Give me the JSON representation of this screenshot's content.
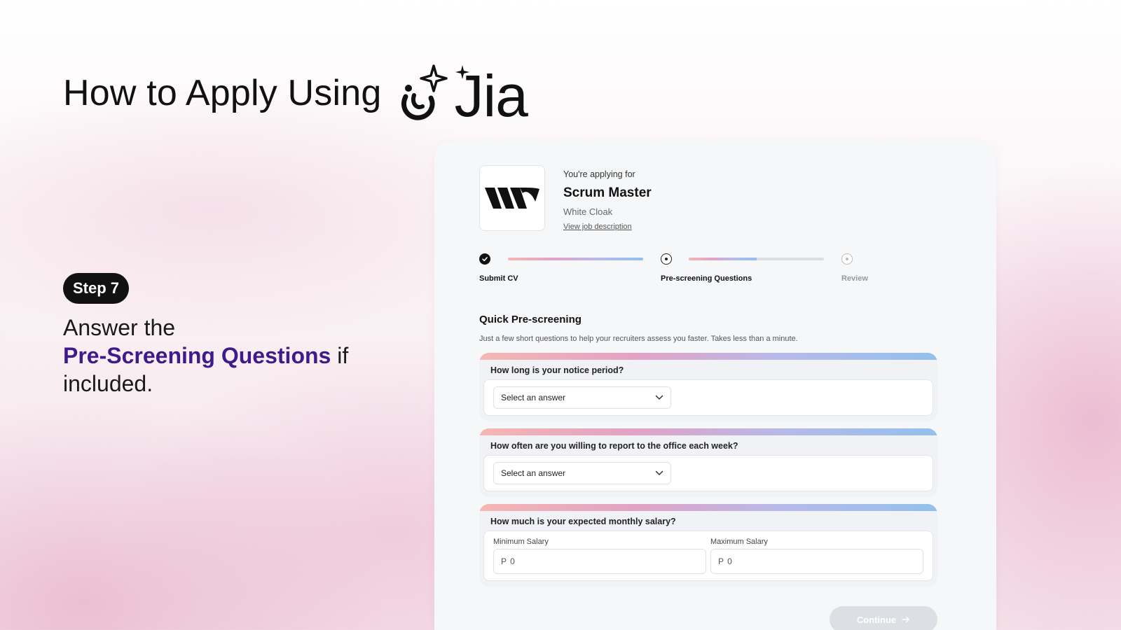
{
  "headline": {
    "text": "How to Apply Using",
    "brand": "Jia"
  },
  "step": {
    "badge": "Step 7",
    "desc_prefix": "Answer the",
    "desc_highlight": "Pre-Screening Questions",
    "desc_suffix": "if included."
  },
  "job": {
    "applying_label": "You're applying for",
    "title": "Scrum Master",
    "company": "White Cloak",
    "view_link": "View job description"
  },
  "stepper": {
    "steps": [
      {
        "label": "Submit CV",
        "state": "done"
      },
      {
        "label": "Pre-screening Questions",
        "state": "current"
      },
      {
        "label": "Review",
        "state": "pending"
      }
    ],
    "progress": [
      1.0,
      0.5
    ]
  },
  "prescreen": {
    "title": "Quick Pre-screening",
    "subtitle": "Just a few short questions to help your recruiters assess you faster. Takes less than a minute.",
    "questions": [
      {
        "title": "How long is your notice period?",
        "placeholder": "Select an answer"
      },
      {
        "title": "How often are you willing to report to the office each week?",
        "placeholder": "Select an answer"
      },
      {
        "title": "How much is your expected monthly salary?",
        "min_label": "Minimum Salary",
        "max_label": "Maximum Salary",
        "min_value": "P 0",
        "max_value": "P 0"
      }
    ]
  },
  "actions": {
    "continue": "Continue"
  },
  "colors": {
    "highlight": "#3f1a8a",
    "progress_gradient": [
      "#f4b7b2",
      "#e3a2c4",
      "#b6b9e9",
      "#93c0ec"
    ]
  }
}
